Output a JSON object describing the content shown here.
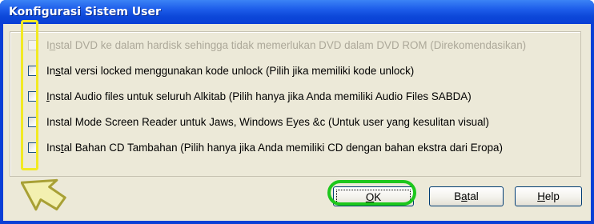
{
  "window": {
    "title": "Konfigurasi Sistem User"
  },
  "options": [
    {
      "pre": "I",
      "key": "n",
      "post": "stal DVD ke dalam hardisk sehingga tidak memerlukan DVD dalam DVD ROM (Direkomendasikan)",
      "enabled": false,
      "checked": false
    },
    {
      "pre": "In",
      "key": "s",
      "post": "tal versi locked menggunakan kode unlock (Pilih jika memiliki kode unlock)",
      "enabled": true,
      "checked": false
    },
    {
      "pre": "",
      "key": "I",
      "post": "nstal Audio files untuk seluruh Alkitab (Pilih hanya jika Anda memiliki Audio Files SABDA)",
      "enabled": true,
      "checked": false
    },
    {
      "pre": "Instal Mode Screen Reader untuk Jaws, Windows Eyes &c (Untuk user yang kesulitan visual)",
      "key": "",
      "post": "",
      "enabled": true,
      "checked": false
    },
    {
      "pre": "Ins",
      "key": "t",
      "post": "al Bahan CD Tambahan (Pilih hanya jika Anda memiliki CD dengan bahan ekstra dari Eropa)",
      "enabled": true,
      "checked": false
    }
  ],
  "buttons": {
    "ok": {
      "key": "O",
      "rest": "K"
    },
    "cancel": {
      "pre": "B",
      "key": "a",
      "rest": "tal"
    },
    "help": {
      "key": "H",
      "rest": "elp"
    }
  },
  "annotations": {
    "highlight_color": "#f2ea22",
    "ring_color": "#1dc71c"
  }
}
